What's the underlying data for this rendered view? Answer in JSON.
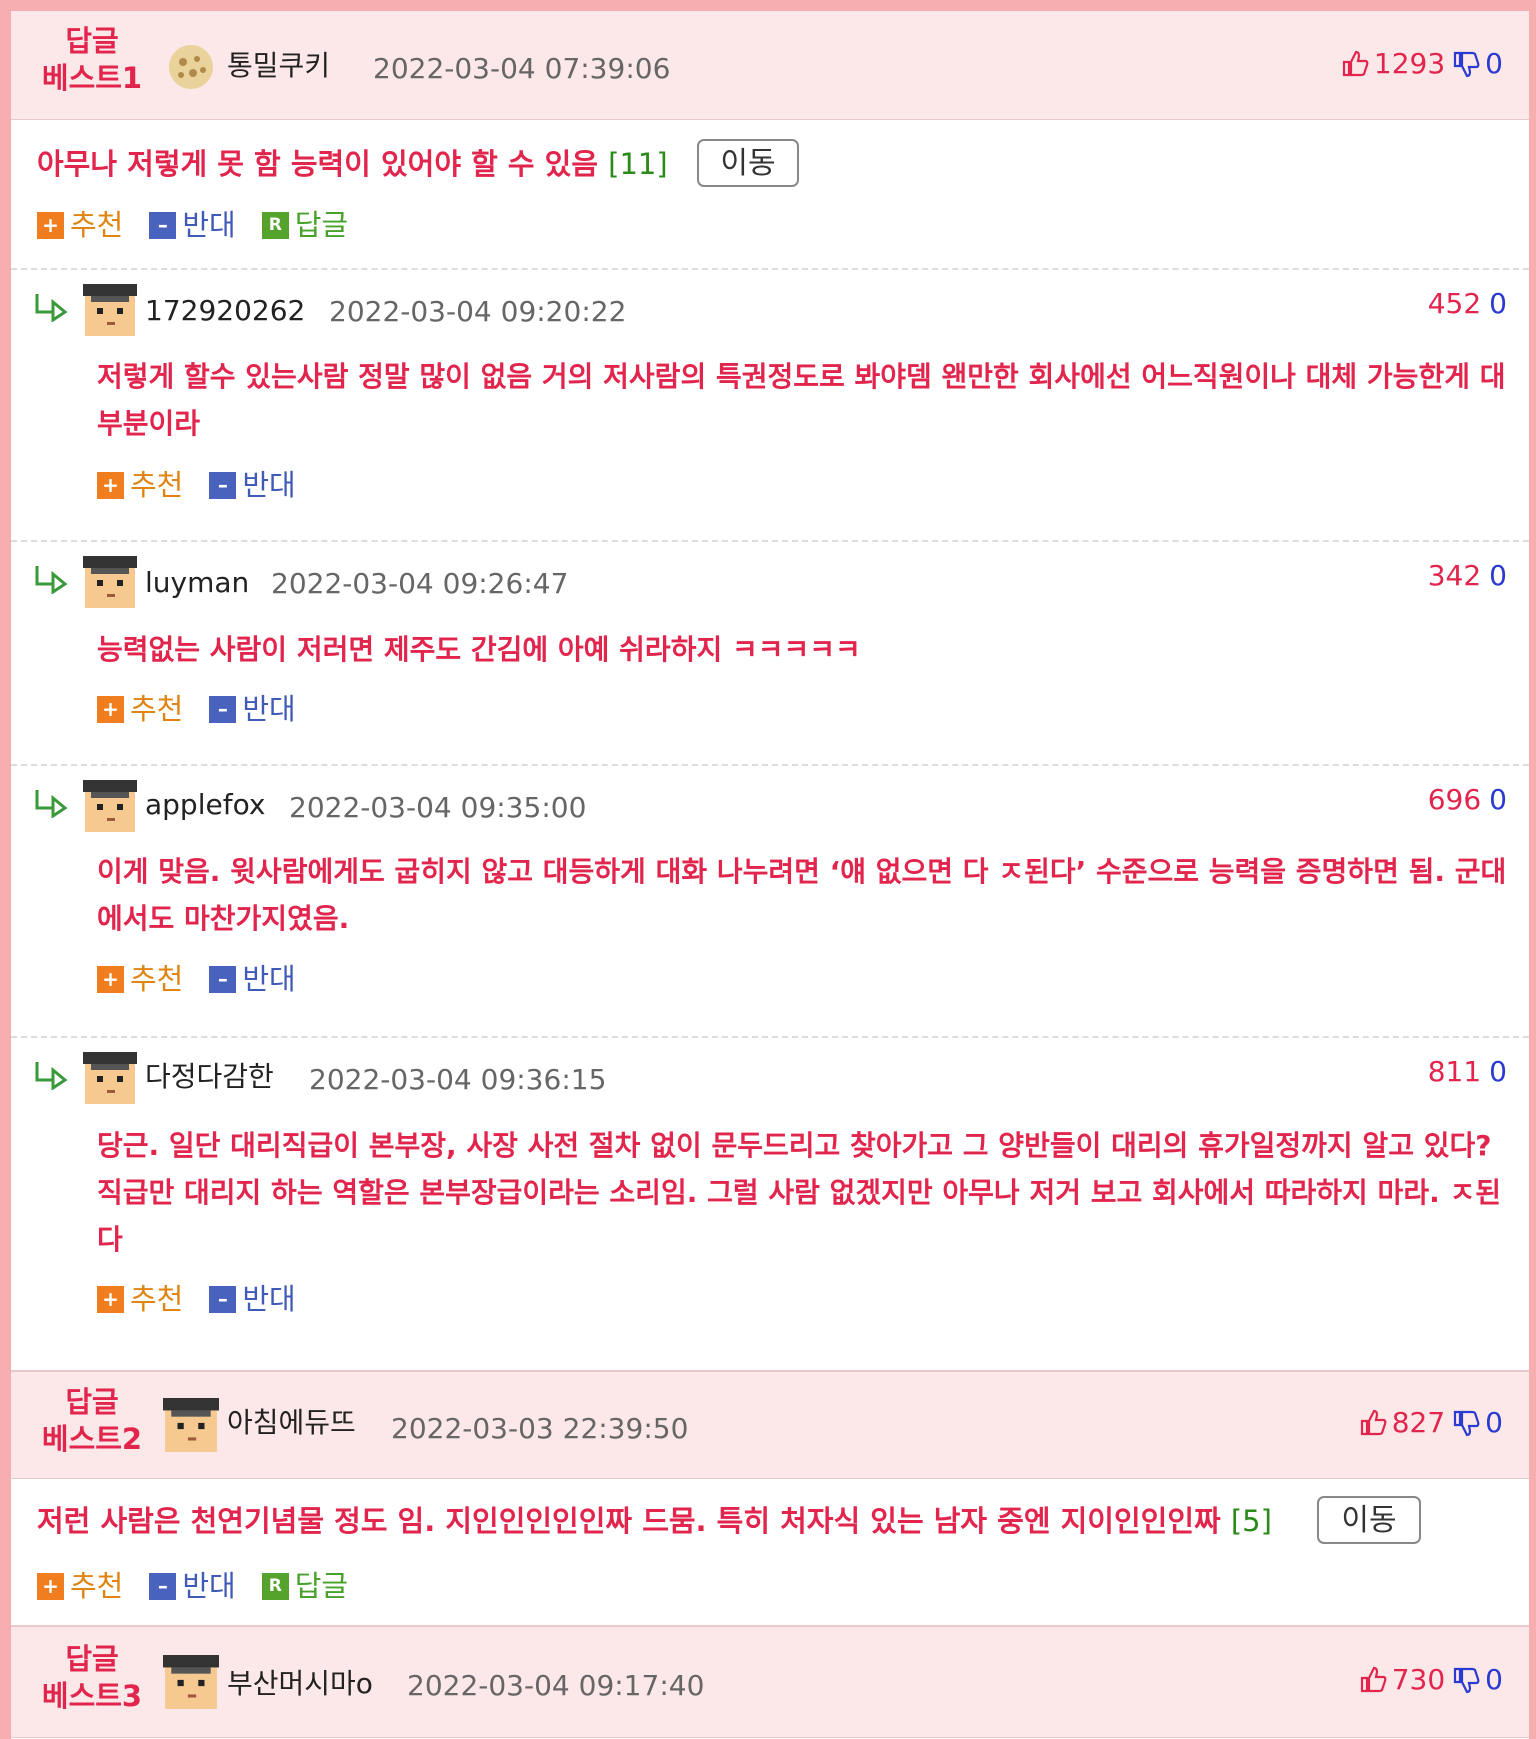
{
  "colors": {
    "accent_red": "#e2254d",
    "accent_blue": "#2a3bd1",
    "best_bg": "#fde8e9",
    "frame": "#f6aeb0"
  },
  "labels": {
    "recommend": "추천",
    "oppose": "반대",
    "reply": "답글",
    "move": "이동",
    "reply_icon_letter": "R"
  },
  "best1": {
    "badge_line1": "답글",
    "badge_line2": "베스트1",
    "avatar_icon": "cookie-avatar-icon",
    "name": "통밀쿠키",
    "time": "2022-03-04 07:39:06",
    "up": "1293",
    "down": "0",
    "text": "아무나 저렇게 못 함 능력이 있어야 할 수 있음",
    "count": "[11]"
  },
  "replies": [
    {
      "name": "172920262",
      "time": "2022-03-04 09:20:22",
      "up": "452",
      "down": "0",
      "text": "저렇게 할수 있는사람 정말 많이 없음 거의 저사람의 특권정도로 봐야뎀 왠만한 회사에선 어느직원이나 대체 가능한게 대부분이라"
    },
    {
      "name": "luyman",
      "time": "2022-03-04 09:26:47",
      "up": "342",
      "down": "0",
      "text": "능력없는 사람이 저러면 제주도 간김에 아예 쉬라하지 ㅋㅋㅋㅋㅋ"
    },
    {
      "name": "applefox",
      "time": "2022-03-04 09:35:00",
      "up": "696",
      "down": "0",
      "text": "이게 맞음. 윗사람에게도 굽히지 않고 대등하게 대화 나누려면 ‘얘 없으면 다 ㅈ된다’ 수준으로 능력을 증명하면 됨. 군대에서도 마찬가지였음."
    },
    {
      "name": "다정다감한",
      "time": "2022-03-04 09:36:15",
      "up": "811",
      "down": "0",
      "text": "당근. 일단 대리직급이 본부장, 사장 사전 절차 없이 문두드리고 찾아가고 그 양반들이 대리의 휴가일정까지 알고 있다? 직급만 대리지 하는 역할은 본부장급이라는 소리임. 그럴 사람 없겠지만 아무나 저거 보고 회사에서 따라하지 마라. ㅈ된다"
    }
  ],
  "best2": {
    "badge_line1": "답글",
    "badge_line2": "베스트2",
    "name": "아침에듀뜨",
    "time": "2022-03-03 22:39:50",
    "up": "827",
    "down": "0",
    "text": "저런 사람은 천연기념물 정도 임. 지인인인인인짜 드뭄. 특히 처자식 있는 남자 중엔 지이인인인짜",
    "count": "[5]"
  },
  "best3": {
    "badge_line1": "답글",
    "badge_line2": "베스트3",
    "name": "부산머시마o",
    "time": "2022-03-04 09:17:40",
    "up": "730",
    "down": "0"
  }
}
